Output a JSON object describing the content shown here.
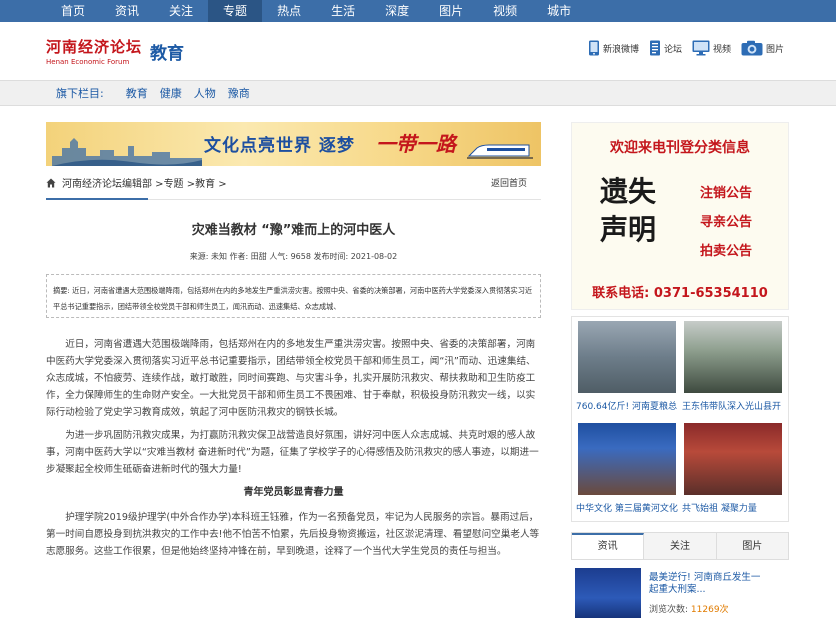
{
  "topnav": [
    "首页",
    "资讯",
    "关注",
    "专题",
    "热点",
    "生活",
    "深度",
    "图片",
    "视频",
    "城市"
  ],
  "topnav_active": 3,
  "header": {
    "logo_cn": "河南经济论坛",
    "logo_en": "Henan Economic Forum",
    "section": "教育",
    "links": [
      "新浪微博",
      "论坛",
      "视频",
      "图片"
    ]
  },
  "subnav": {
    "label": "旗下栏目:",
    "items": [
      "教育",
      "健康",
      "人物",
      "豫商"
    ]
  },
  "banner": {
    "title": "文化点亮世界  逐梦",
    "script": "一带一路"
  },
  "breadcrumb": {
    "items": [
      "河南经济论坛编辑部 >",
      "专题 >",
      "教育 >"
    ],
    "back": "返回首页"
  },
  "article": {
    "title": "灾难当教材 “豫”难而上的河中医人",
    "meta": "来源: 未知 作者: 田甜 人气: 9658 发布时间: 2021-08-02",
    "summary": "摘要: 近日，河南省遭遇大范围极端降雨，包括郑州在内的多地发生严重洪涝灾害。按照中央、省委的决策部署，河南中医药大学党委深入贯彻落实习近平总书记重要指示，团结带领全校党员干部和师生员工，闻汛而动、迅速集结、众志成城、",
    "paragraphs": [
      "近日，河南省遭遇大范围极端降雨，包括郑州在内的多地发生严重洪涝灾害。按照中央、省委的决策部署，河南中医药大学党委深入贯彻落实习近平总书记重要指示，团结带领全校党员干部和师生员工，闻“汛”而动、迅速集结、众志成城，不怕疲劳、连续作战，敢打敢胜，同时间赛跑、与灾害斗争，扎实开展防汛救灾、帮扶救助和卫生防疫工作，全力保障师生的生命财产安全。一大批党员干部和师生员工不畏困难、甘于奉献，积极投身防汛救灾一线，以实际行动检验了党史学习教育成效，筑起了河中医防汛救灾的钢铁长城。",
      "为进一步巩固防汛救灾成果，为打赢防汛救灾保卫战营造良好氛围，讲好河中医人众志成城、共克时艰的感人故事，河南中医药大学以“灾难当教材 奋进新时代”为题，征集了学校学子的心得感悟及防汛救灾的感人事迹，以期进一步凝聚起全校师生砥砺奋进新时代的强大力量!"
    ],
    "subheading": "青年党员彰显青春力量",
    "paragraph3": "护理学院2019级护理学(中外合作办学)本科班王钰雅，作为一名预备党员，牢记为人民服务的宗旨。暴雨过后，第一时间自愿投身到抗洪救灾的工作中去!他不怕苦不怕累，先后投身物资搬运，社区淤泥清理、看望慰问空巢老人等志愿服务。这些工作很累，但是他始终坚持冲锋在前，早到晚退，诠释了一个当代大学生党员的责任与担当。"
  },
  "ad": {
    "top": "欢迎来电刊登分类信息",
    "big": [
      "遗失",
      "声明"
    ],
    "list": [
      "注销公告",
      "寻亲公告",
      "拍卖公告"
    ],
    "phone": "联系电话: 0371-65354110"
  },
  "pics": [
    {
      "caption": "760.64亿斤! 河南夏粮总"
    },
    {
      "caption": "王东伟带队深入光山县开"
    },
    {
      "caption": "中华文化 第三届黄河文化"
    },
    {
      "caption": "共飞始祖 凝聚力量"
    }
  ],
  "tabs": [
    "资讯",
    "关注",
    "图片"
  ],
  "hot": {
    "title": "最美逆行! 河南商丘发生一起重大刑案...",
    "views_label": "浏览次数:",
    "views": "11269次"
  }
}
